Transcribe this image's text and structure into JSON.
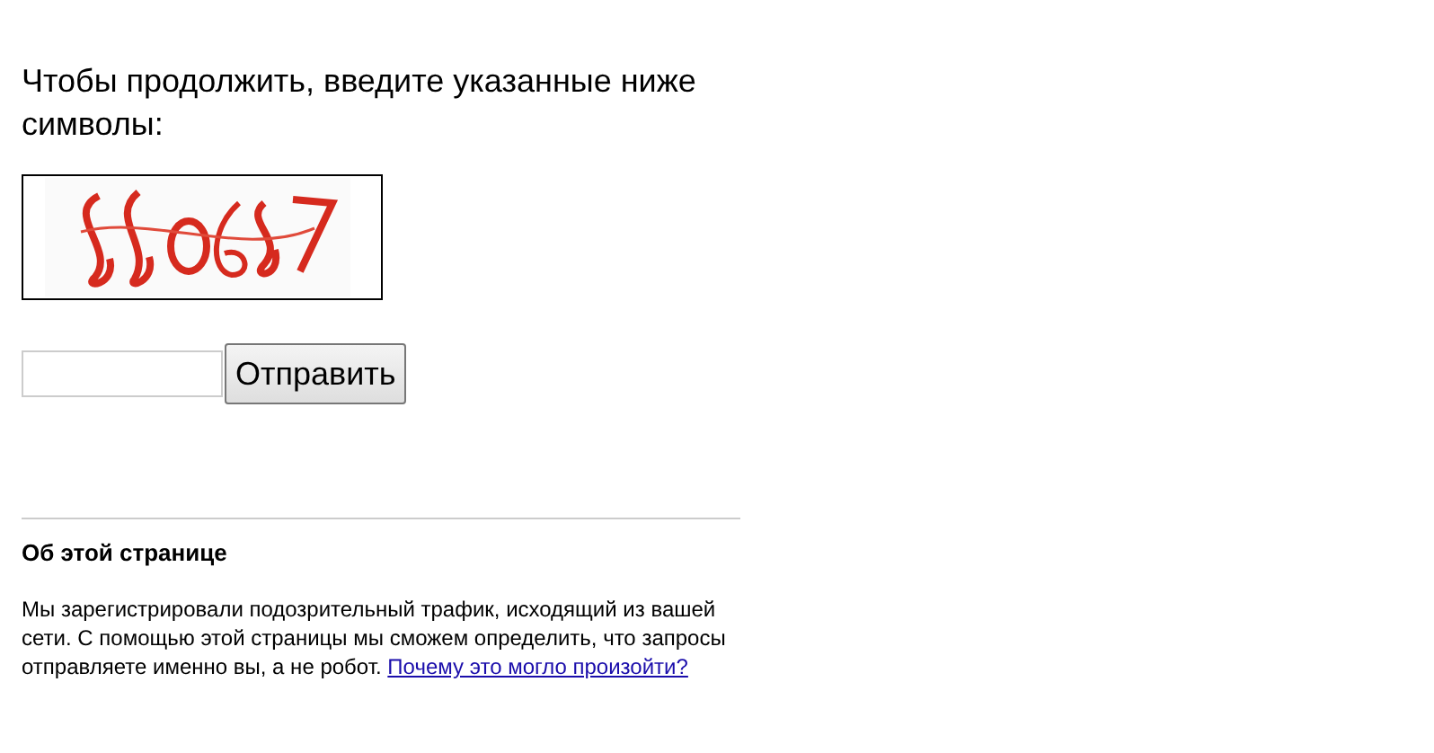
{
  "prompt": "Чтобы продолжить, введите указанные ниже символы:",
  "submit_button": "Отправить",
  "about": {
    "title": "Об этой странице",
    "text": "Мы зарегистрировали подозрительный трафик, исходящий из вашей сети. С помощью этой страницы мы сможем определить, что запросы отправляете именно вы, а не робот.",
    "link": "Почему это могло произойти?"
  }
}
